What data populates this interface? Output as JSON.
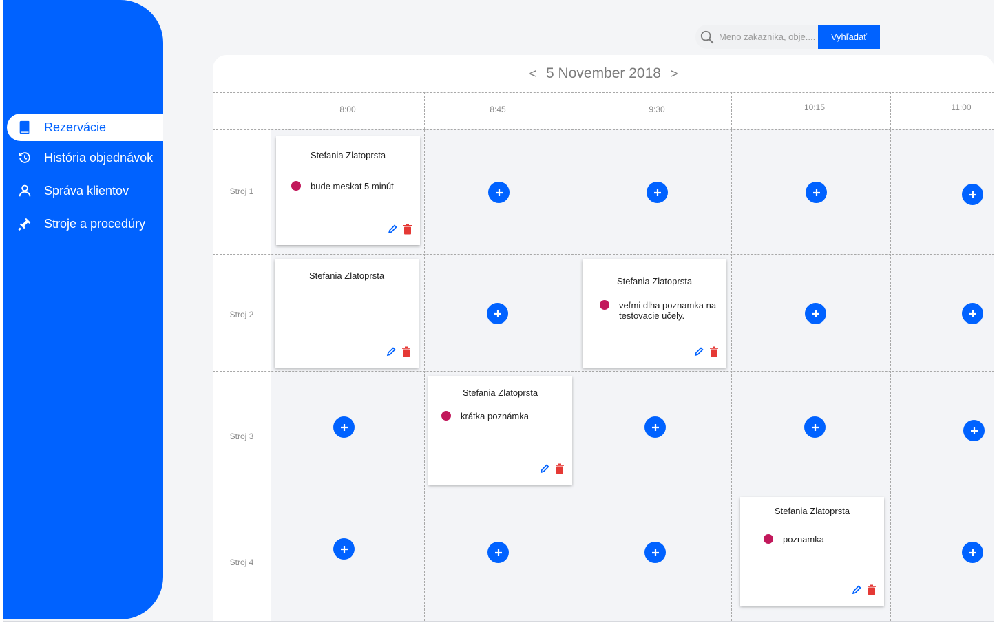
{
  "colors": {
    "accent": "#0062ff",
    "note_dot": "#c2185b",
    "delete": "#e53935"
  },
  "sidebar": {
    "items": [
      {
        "label": "Rezervácie",
        "icon": "book-icon",
        "active": true
      },
      {
        "label": "História objednávok",
        "icon": "history-icon",
        "active": false
      },
      {
        "label": "Správa klientov",
        "icon": "person-icon",
        "active": false
      },
      {
        "label": "Stroje a procedúry",
        "icon": "tool-icon",
        "active": false
      }
    ]
  },
  "search": {
    "placeholder": "Meno zakaznika, obje....",
    "button_label": "Vyhľadať"
  },
  "calendar": {
    "prev_label": "<",
    "next_label": ">",
    "date": "5 November 2018",
    "times": [
      "8:00",
      "8:45",
      "9:30",
      "10:15",
      "11:00"
    ],
    "rows": [
      "Stroj 1",
      "Stroj 2",
      "Stroj 3",
      "Stroj 4"
    ],
    "bookings": [
      {
        "row": 0,
        "col": 0,
        "client": "Stefania Zlatoprsta",
        "note": "bude meskat 5 minút"
      },
      {
        "row": 1,
        "col": 0,
        "client": "Stefania Zlatoprsta",
        "note": ""
      },
      {
        "row": 1,
        "col": 2,
        "client": "Stefania Zlatoprsta",
        "note": "veľmi dlha poznamka na testovacie učely."
      },
      {
        "row": 2,
        "col": 1,
        "client": "Stefania Zlatoprsta",
        "note": "krátka poznámka"
      },
      {
        "row": 3,
        "col": 3,
        "client": "Stefania Zlatoprsta",
        "note": "poznamka"
      }
    ]
  }
}
